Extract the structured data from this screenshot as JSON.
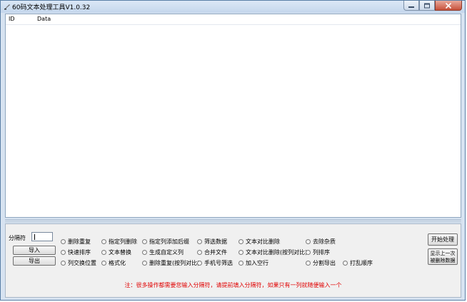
{
  "window": {
    "title": "60码文本处理工具V1.0.32"
  },
  "grid": {
    "columns": [
      "ID",
      "Data"
    ]
  },
  "separator": {
    "label": "分隔符",
    "value": ""
  },
  "buttons": {
    "import": "导入",
    "export": "导出",
    "start": "开始处理",
    "restore": "显示上一次被删除数据"
  },
  "options": [
    [
      "删除重复",
      "指定列删除",
      "指定列添加后缀",
      "筛选数据",
      "文本对比删除",
      "去除杂质"
    ],
    [
      "快速排序",
      "文本替换",
      "生成自定义列",
      "合并文件",
      "文本对比删除(按列对比)",
      "列排序"
    ],
    [
      "列交换位置",
      "格式化",
      "删除重复(按列对比)",
      "手机号筛选",
      "加入空行",
      "分割导出",
      "打乱顺序"
    ]
  ],
  "note": "注：很多操作都需要您输入分隔符，请提前填入分隔符，如果只有一列就随便输入一个"
}
